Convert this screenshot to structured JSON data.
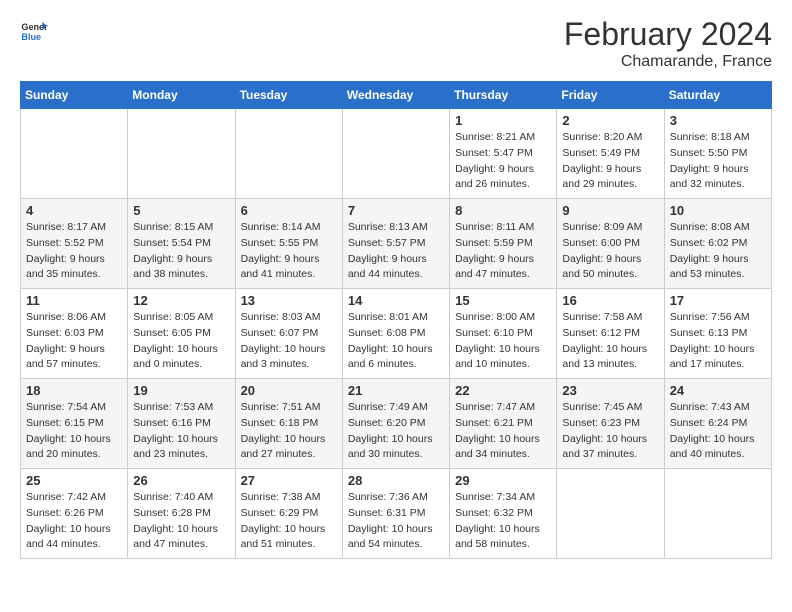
{
  "logo": {
    "text_general": "General",
    "text_blue": "Blue"
  },
  "title": "February 2024",
  "subtitle": "Chamarande, France",
  "days_of_week": [
    "Sunday",
    "Monday",
    "Tuesday",
    "Wednesday",
    "Thursday",
    "Friday",
    "Saturday"
  ],
  "weeks": [
    [
      {
        "day": "",
        "empty": true
      },
      {
        "day": "",
        "empty": true
      },
      {
        "day": "",
        "empty": true
      },
      {
        "day": "",
        "empty": true
      },
      {
        "day": "1",
        "sunrise": "8:21 AM",
        "sunset": "5:47 PM",
        "daylight": "9 hours and 26 minutes."
      },
      {
        "day": "2",
        "sunrise": "8:20 AM",
        "sunset": "5:49 PM",
        "daylight": "9 hours and 29 minutes."
      },
      {
        "day": "3",
        "sunrise": "8:18 AM",
        "sunset": "5:50 PM",
        "daylight": "9 hours and 32 minutes."
      }
    ],
    [
      {
        "day": "4",
        "sunrise": "8:17 AM",
        "sunset": "5:52 PM",
        "daylight": "9 hours and 35 minutes."
      },
      {
        "day": "5",
        "sunrise": "8:15 AM",
        "sunset": "5:54 PM",
        "daylight": "9 hours and 38 minutes."
      },
      {
        "day": "6",
        "sunrise": "8:14 AM",
        "sunset": "5:55 PM",
        "daylight": "9 hours and 41 minutes."
      },
      {
        "day": "7",
        "sunrise": "8:13 AM",
        "sunset": "5:57 PM",
        "daylight": "9 hours and 44 minutes."
      },
      {
        "day": "8",
        "sunrise": "8:11 AM",
        "sunset": "5:59 PM",
        "daylight": "9 hours and 47 minutes."
      },
      {
        "day": "9",
        "sunrise": "8:09 AM",
        "sunset": "6:00 PM",
        "daylight": "9 hours and 50 minutes."
      },
      {
        "day": "10",
        "sunrise": "8:08 AM",
        "sunset": "6:02 PM",
        "daylight": "9 hours and 53 minutes."
      }
    ],
    [
      {
        "day": "11",
        "sunrise": "8:06 AM",
        "sunset": "6:03 PM",
        "daylight": "9 hours and 57 minutes."
      },
      {
        "day": "12",
        "sunrise": "8:05 AM",
        "sunset": "6:05 PM",
        "daylight": "10 hours and 0 minutes."
      },
      {
        "day": "13",
        "sunrise": "8:03 AM",
        "sunset": "6:07 PM",
        "daylight": "10 hours and 3 minutes."
      },
      {
        "day": "14",
        "sunrise": "8:01 AM",
        "sunset": "6:08 PM",
        "daylight": "10 hours and 6 minutes."
      },
      {
        "day": "15",
        "sunrise": "8:00 AM",
        "sunset": "6:10 PM",
        "daylight": "10 hours and 10 minutes."
      },
      {
        "day": "16",
        "sunrise": "7:58 AM",
        "sunset": "6:12 PM",
        "daylight": "10 hours and 13 minutes."
      },
      {
        "day": "17",
        "sunrise": "7:56 AM",
        "sunset": "6:13 PM",
        "daylight": "10 hours and 17 minutes."
      }
    ],
    [
      {
        "day": "18",
        "sunrise": "7:54 AM",
        "sunset": "6:15 PM",
        "daylight": "10 hours and 20 minutes."
      },
      {
        "day": "19",
        "sunrise": "7:53 AM",
        "sunset": "6:16 PM",
        "daylight": "10 hours and 23 minutes."
      },
      {
        "day": "20",
        "sunrise": "7:51 AM",
        "sunset": "6:18 PM",
        "daylight": "10 hours and 27 minutes."
      },
      {
        "day": "21",
        "sunrise": "7:49 AM",
        "sunset": "6:20 PM",
        "daylight": "10 hours and 30 minutes."
      },
      {
        "day": "22",
        "sunrise": "7:47 AM",
        "sunset": "6:21 PM",
        "daylight": "10 hours and 34 minutes."
      },
      {
        "day": "23",
        "sunrise": "7:45 AM",
        "sunset": "6:23 PM",
        "daylight": "10 hours and 37 minutes."
      },
      {
        "day": "24",
        "sunrise": "7:43 AM",
        "sunset": "6:24 PM",
        "daylight": "10 hours and 40 minutes."
      }
    ],
    [
      {
        "day": "25",
        "sunrise": "7:42 AM",
        "sunset": "6:26 PM",
        "daylight": "10 hours and 44 minutes."
      },
      {
        "day": "26",
        "sunrise": "7:40 AM",
        "sunset": "6:28 PM",
        "daylight": "10 hours and 47 minutes."
      },
      {
        "day": "27",
        "sunrise": "7:38 AM",
        "sunset": "6:29 PM",
        "daylight": "10 hours and 51 minutes."
      },
      {
        "day": "28",
        "sunrise": "7:36 AM",
        "sunset": "6:31 PM",
        "daylight": "10 hours and 54 minutes."
      },
      {
        "day": "29",
        "sunrise": "7:34 AM",
        "sunset": "6:32 PM",
        "daylight": "10 hours and 58 minutes."
      },
      {
        "day": "",
        "empty": true
      },
      {
        "day": "",
        "empty": true
      }
    ]
  ]
}
